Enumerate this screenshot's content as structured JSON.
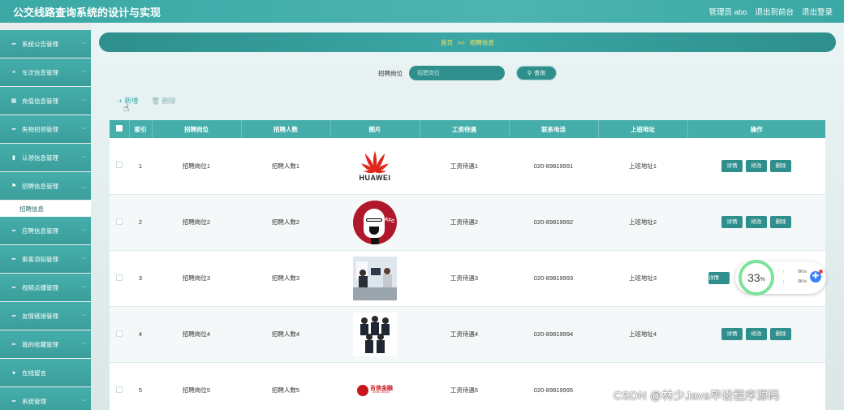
{
  "app": {
    "title": "公交线路查询系统的设计与实现"
  },
  "topnav": {
    "admin": "管理员 abo",
    "front": "退出到前台",
    "logout": "退出登录"
  },
  "sidebar": {
    "items": [
      {
        "icon": "grid-icon",
        "label": "系统公告管理"
      },
      {
        "icon": "list-icon",
        "label": "车次信息管理"
      },
      {
        "icon": "table-icon",
        "label": "充值信息管理"
      },
      {
        "icon": "grid-icon",
        "label": "失物招领管理"
      },
      {
        "icon": "trash-icon",
        "label": "认领信息管理"
      },
      {
        "icon": "flag-icon",
        "label": "招聘信息管理"
      }
    ],
    "active_sub": "招聘信息",
    "items_after": [
      {
        "icon": "grid-icon",
        "label": "应聘信息管理"
      },
      {
        "icon": "grid-icon",
        "label": "乘客须知管理"
      },
      {
        "icon": "grid-icon",
        "label": "视频点播管理"
      },
      {
        "icon": "grid-icon",
        "label": "友情链接管理"
      },
      {
        "icon": "grid-icon",
        "label": "我的收藏管理"
      },
      {
        "icon": "pin-icon",
        "label": "在线留言"
      },
      {
        "icon": "grid-icon",
        "label": "系统管理"
      }
    ]
  },
  "breadcrumb": {
    "home": "首页",
    "sep": ">>",
    "current": "招聘信息"
  },
  "search": {
    "label": "招聘岗位",
    "placeholder": "招聘岗位",
    "button": "查询"
  },
  "actions": {
    "add": "+ 新增",
    "delete": "删除"
  },
  "table": {
    "headers": [
      "",
      "索引",
      "招聘岗位",
      "招聘人数",
      "图片",
      "工资待遇",
      "联系电话",
      "上班地址",
      "操作"
    ],
    "rows": [
      {
        "index": "1",
        "position": "招聘岗位1",
        "count": "招聘人数1",
        "image": "huawei-logo",
        "salary": "工资待遇1",
        "phone": "020-89819991",
        "address": "上班地址1"
      },
      {
        "index": "2",
        "position": "招聘岗位2",
        "count": "招聘人数2",
        "image": "kfc-logo",
        "salary": "工资待遇2",
        "phone": "020-89819992",
        "address": "上班地址2"
      },
      {
        "index": "3",
        "position": "招聘岗位3",
        "count": "招聘人数3",
        "image": "office-photo",
        "salary": "工资待遇3",
        "phone": "020-89819993",
        "address": "上班地址3"
      },
      {
        "index": "4",
        "position": "招聘岗位4",
        "count": "招聘人数4",
        "image": "team-photo",
        "salary": "工资待遇4",
        "phone": "020-89819994",
        "address": "上班地址4"
      },
      {
        "index": "5",
        "position": "招聘岗位5",
        "count": "招聘人数5",
        "image": "jixin-logo",
        "salary": "工资待遇5",
        "phone": "020-89819995",
        "address": ""
      }
    ],
    "ops": {
      "detail": "详情",
      "edit": "修改",
      "delete": "删除"
    }
  },
  "logos": {
    "huawei": "HUAWEI",
    "kfc": "KFC",
    "jixin_cn": "吉信金融",
    "jixin_en": "JIXIN CREDIT"
  },
  "widget": {
    "percent": "33",
    "unit": "%",
    "up": "0K/s",
    "down": "0K/s"
  },
  "watermark": "CSDN @林少Java毕设程序源码",
  "colors": {
    "primary": "#45aeab",
    "dark": "#2e8f8c",
    "accent": "#ffe75c"
  }
}
